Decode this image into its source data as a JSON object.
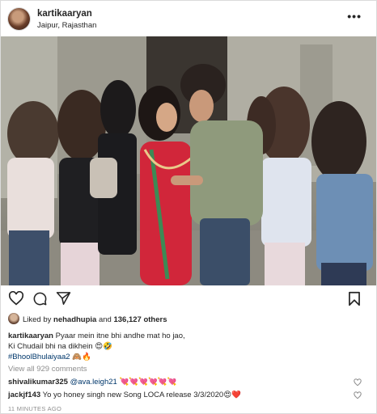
{
  "post": {
    "username": "kartikaaryan",
    "location": "Jaipur, Rajasthan",
    "more_label": "•••",
    "liked_by_prefix": "Liked by ",
    "liked_by_user": "nehadhupia",
    "liked_by_and": " and ",
    "liked_by_others": "136,127 others",
    "caption_user": "kartikaaryan",
    "caption_line1": " Pyaar mein itne bhi andhe mat ho jao,",
    "caption_line2": "Ki Chudail bhi na dikhein 😍🤣",
    "caption_hashtag": "#BhoolBhulaiyaa2",
    "caption_emojis": " 🙈🔥",
    "view_all": "View all 929 comments",
    "comments": [
      {
        "user": "shivalikumar325",
        "mention": "@ava.leigh21",
        "text": " 💘💘💘💘💘💘"
      },
      {
        "user": "jackjf143",
        "mention": "",
        "text": " Yo yo honey singh new Song LOCA release 3/3/2020😍❤️"
      }
    ],
    "timestamp": "11 MINUTES AGO"
  },
  "icons": {
    "like": "heart-icon",
    "comment": "comment-icon",
    "share": "share-icon",
    "save": "bookmark-icon",
    "more": "more-icon"
  }
}
